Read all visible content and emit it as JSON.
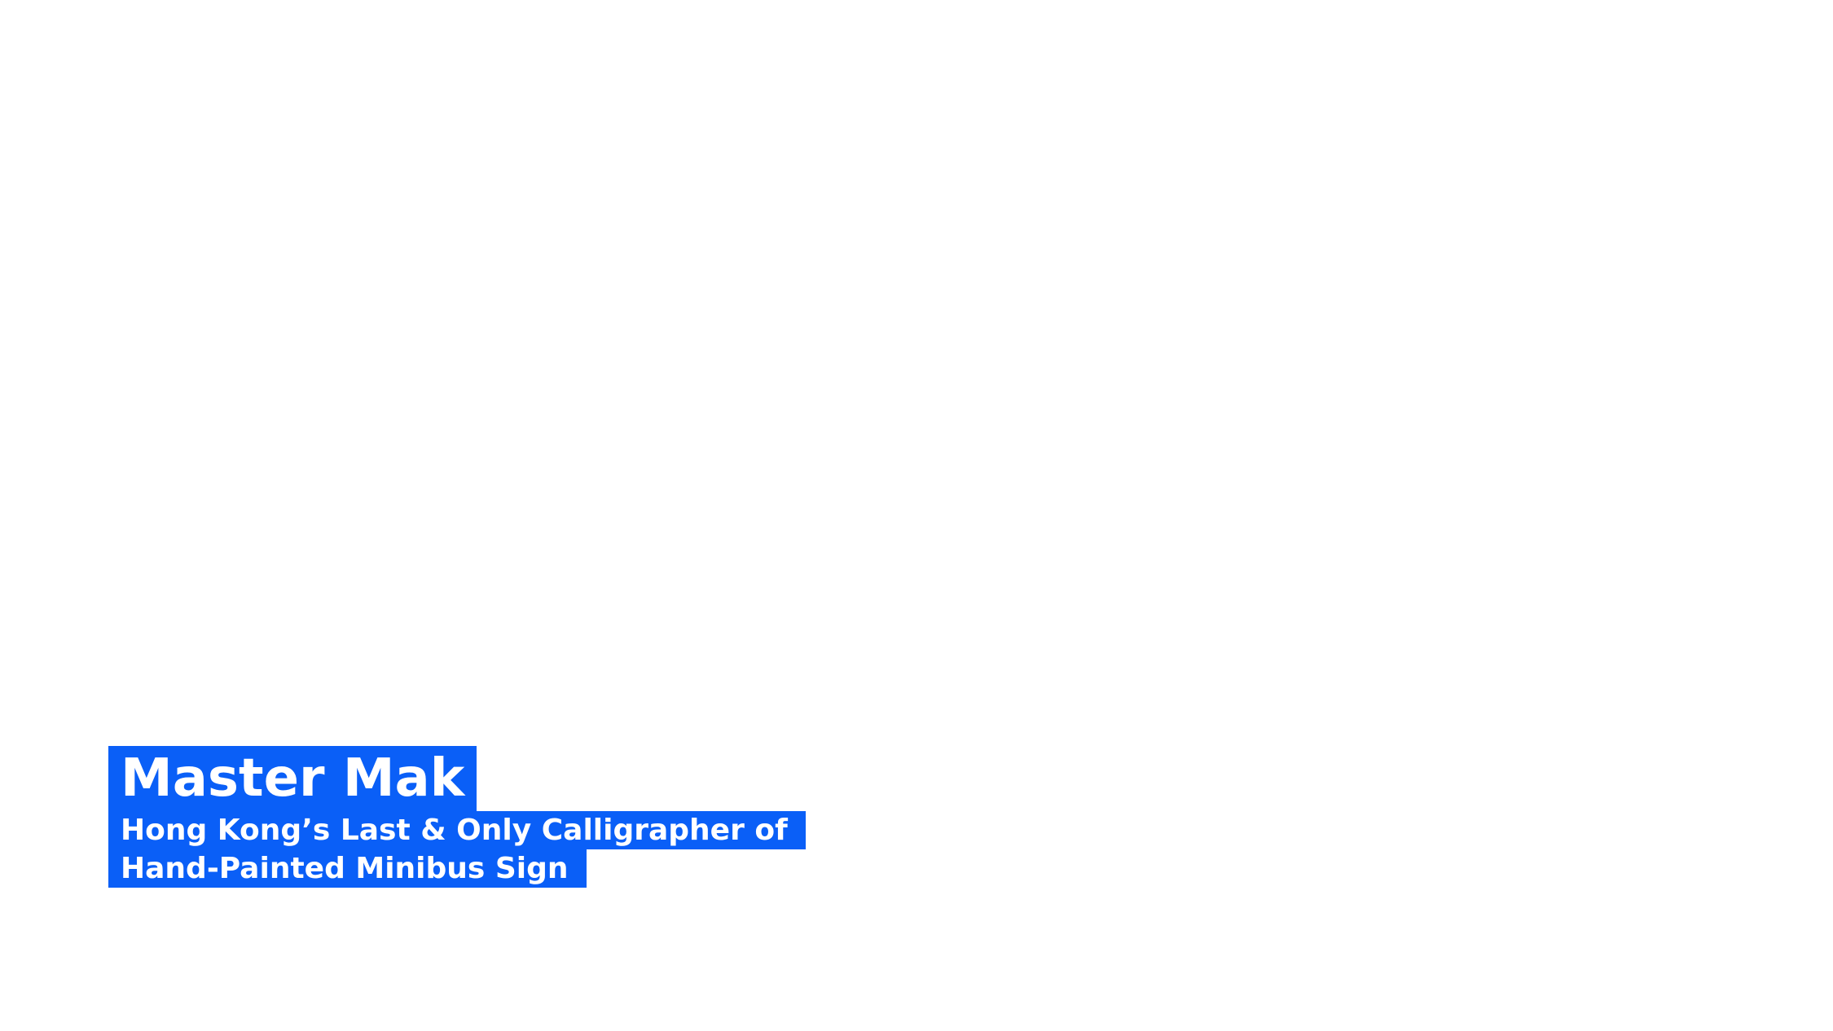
{
  "caption": {
    "title": "Master Mak",
    "subtitle_lines": [
      "Hong Kong’s Last & Only Calligrapher of",
      "Hand-Painted Minibus Sign"
    ]
  },
  "colors": {
    "background": "#ffffff",
    "caption_box": "#0a5ff7",
    "caption_text": "#ffffff"
  }
}
